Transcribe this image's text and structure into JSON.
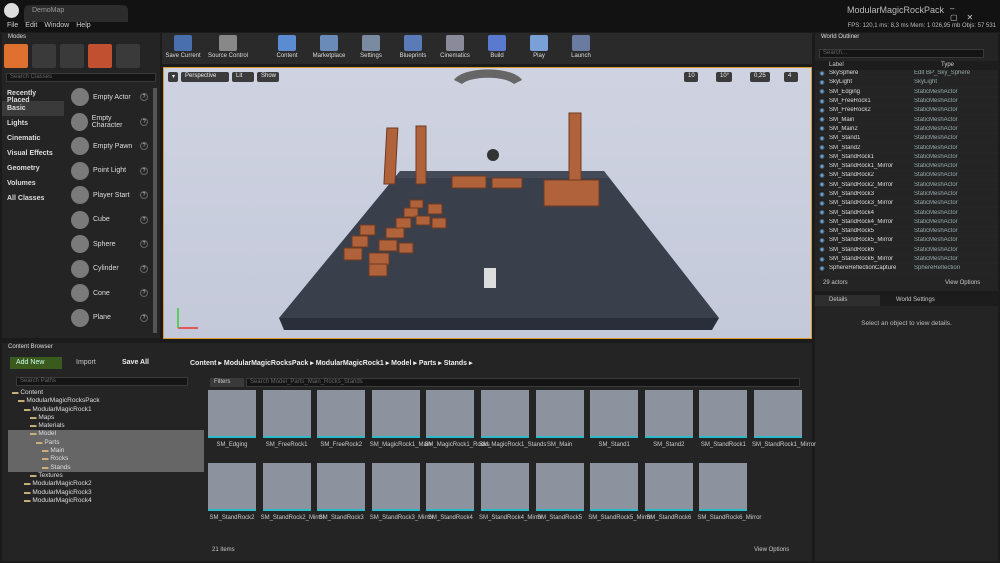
{
  "window": {
    "doc_tab": "DemoMap",
    "project": "ModularMagicRockPack",
    "stats": "FPS: 120,1   ms: 8,3 ms   Mem: 1 026,95 mb   Objs: 57 531"
  },
  "menu": [
    "File",
    "Edit",
    "Window",
    "Help"
  ],
  "modes": {
    "title": "Modes",
    "search_placeholder": "Search Classes",
    "categories": [
      "Recently Placed",
      "Basic",
      "Lights",
      "Cinematic",
      "Visual Effects",
      "Geometry",
      "Volumes",
      "All Classes"
    ],
    "selected_category": "Basic",
    "items": [
      "Empty Actor",
      "Empty Character",
      "Empty Pawn",
      "Point Light",
      "Player Start",
      "Cube",
      "Sphere",
      "Cylinder",
      "Cone",
      "Plane"
    ]
  },
  "toolbar": {
    "buttons": [
      "Save Current",
      "Source Control",
      "Content",
      "Marketplace",
      "Settings",
      "Blueprints",
      "Cinematics",
      "Build",
      "Play",
      "Launch"
    ]
  },
  "viewport": {
    "perspective": "Perspective",
    "lit": "Lit",
    "show": "Show",
    "grid": "10",
    "angle": "10°",
    "scale": "0,25",
    "camera_speed": "4"
  },
  "outliner": {
    "title": "World Outliner",
    "search_placeholder": "Search...",
    "col_label": "Label",
    "col_type": "Type",
    "rows": [
      [
        "SkySphere",
        "Edit BP_Sky_Sphere"
      ],
      [
        "SkyLight",
        "SkyLight"
      ],
      [
        "SM_Edging",
        "StaticMeshActor"
      ],
      [
        "SM_FreeRock1",
        "StaticMeshActor"
      ],
      [
        "SM_FreeRock2",
        "StaticMeshActor"
      ],
      [
        "SM_Main",
        "StaticMeshActor"
      ],
      [
        "SM_Main2",
        "StaticMeshActor"
      ],
      [
        "SM_Stand1",
        "StaticMeshActor"
      ],
      [
        "SM_Stand2",
        "StaticMeshActor"
      ],
      [
        "SM_StandRock1",
        "StaticMeshActor"
      ],
      [
        "SM_StandRock1_Mirror",
        "StaticMeshActor"
      ],
      [
        "SM_StandRock2",
        "StaticMeshActor"
      ],
      [
        "SM_StandRock2_Mirror",
        "StaticMeshActor"
      ],
      [
        "SM_StandRock3",
        "StaticMeshActor"
      ],
      [
        "SM_StandRock3_Mirror",
        "StaticMeshActor"
      ],
      [
        "SM_StandRock4",
        "StaticMeshActor"
      ],
      [
        "SM_StandRock4_Mirror",
        "StaticMeshActor"
      ],
      [
        "SM_StandRock5",
        "StaticMeshActor"
      ],
      [
        "SM_StandRock5_Mirror",
        "StaticMeshActor"
      ],
      [
        "SM_StandRock6",
        "StaticMeshActor"
      ],
      [
        "SM_StandRock6_Mirror",
        "StaticMeshActor"
      ],
      [
        "SphereReflectionCapture",
        "SphereReflection"
      ]
    ],
    "actor_count": "29 actors",
    "view_options": "View Options"
  },
  "details": {
    "tab1": "Details",
    "tab2": "World Settings",
    "empty": "Select an object to view details."
  },
  "content_browser": {
    "title": "Content Browser",
    "add_new": "Add New",
    "import": "Import",
    "save_all": "Save All",
    "breadcrumb": [
      "Content",
      "ModularMagicRocksPack",
      "ModularMagicRock1",
      "Model",
      "Parts",
      "Stands"
    ],
    "search_paths": "Search Paths",
    "filters": "Filters",
    "search_assets": "Search Model_Parts_Main_Rocks_Stands",
    "tree": [
      "Content",
      "ModularMagicRocksPack",
      "ModularMagicRock1",
      "Maps",
      "Materials",
      "Model",
      "Parts",
      "Main",
      "Rocks",
      "Stands",
      "Textures",
      "ModularMagicRock2",
      "ModularMagicRock3",
      "ModularMagicRock4"
    ],
    "assets": [
      "SM_Edging",
      "SM_FreeRock1",
      "SM_FreeRock2",
      "SM_MagicRock1_Main",
      "SM_MagicRock1_Rocks",
      "SM_MagicRock1_Stands",
      "SM_Main",
      "SM_Stand1",
      "SM_Stand2",
      "SM_StandRock1",
      "SM_StandRock1_Mirror",
      "SM_StandRock2",
      "SM_StandRock2_Mirror",
      "SM_StandRock3",
      "SM_StandRock3_Mirror",
      "SM_StandRock4",
      "SM_StandRock4_Mirror",
      "SM_StandRock5",
      "SM_StandRock5_Mirror",
      "SM_StandRock6",
      "SM_StandRock6_Mirror"
    ],
    "item_count": "21 items",
    "view_options": "View Options"
  }
}
